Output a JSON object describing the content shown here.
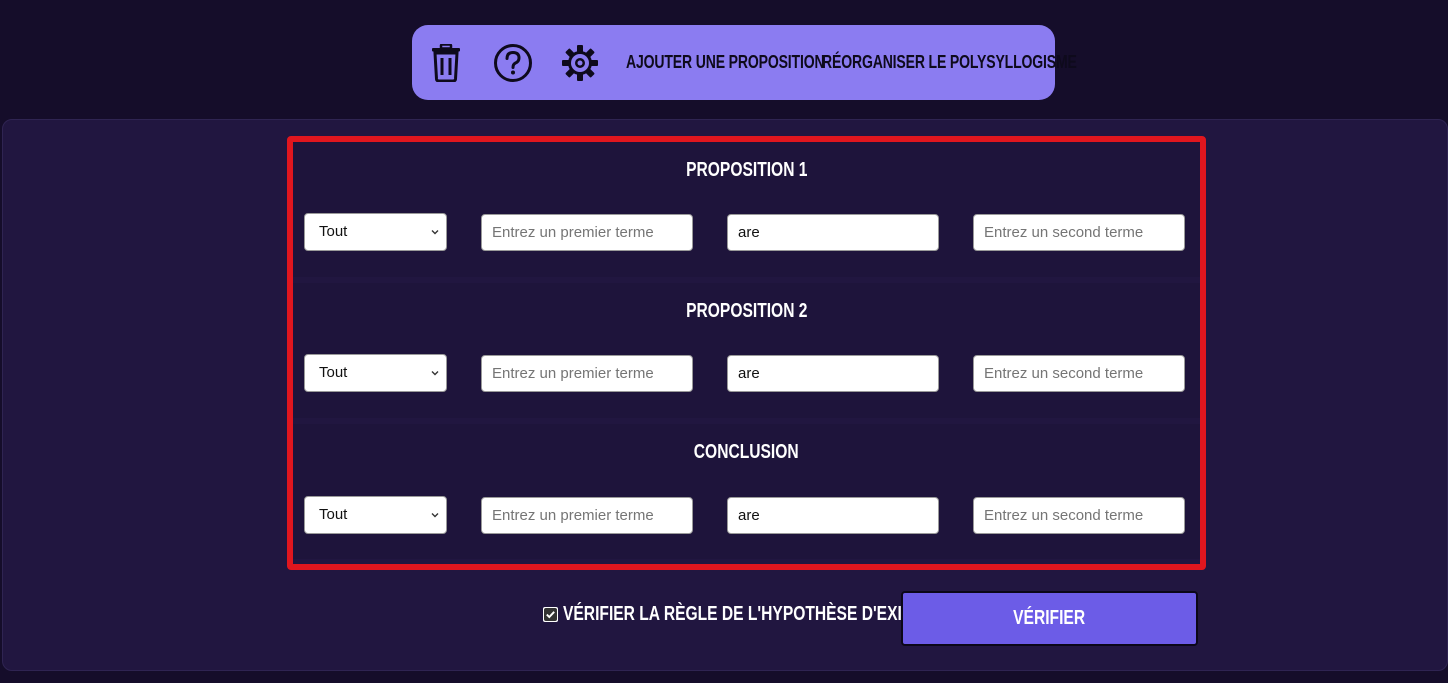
{
  "toolbar": {
    "icons": [
      "trash-icon",
      "help-circle-icon",
      "gear-icon"
    ],
    "add_proposition": "Ajouter une proposition",
    "reorganize": "Réorganiser le polysyllogisme",
    "background_color": "#8b7cf1"
  },
  "propositions": [
    {
      "title": "Proposition 1",
      "quantifier": "Tout",
      "first_term_placeholder": "Entrez un premier terme",
      "first_term_value": "",
      "copula": "are",
      "second_term_placeholder": "Entrez un second terme",
      "second_term_value": ""
    },
    {
      "title": "Proposition 2",
      "quantifier": "Tout",
      "first_term_placeholder": "Entrez un premier terme",
      "first_term_value": "",
      "copula": "are",
      "second_term_placeholder": "Entrez un second terme",
      "second_term_value": ""
    },
    {
      "title": "Conclusion",
      "quantifier": "Tout",
      "first_term_placeholder": "Entrez un premier terme",
      "first_term_value": "",
      "copula": "are",
      "second_term_placeholder": "Entrez un second terme",
      "second_term_value": ""
    }
  ],
  "footer": {
    "existence_check_label": "Vérifier la règle de l'hypothèse d'existence",
    "existence_check_checked": true,
    "verify_button": "Vérifier"
  },
  "colors": {
    "page_bg": "#150d2a",
    "panel_bg": "#211640",
    "highlight_border": "#e0161e",
    "button_accent": "#6c5ce7"
  }
}
